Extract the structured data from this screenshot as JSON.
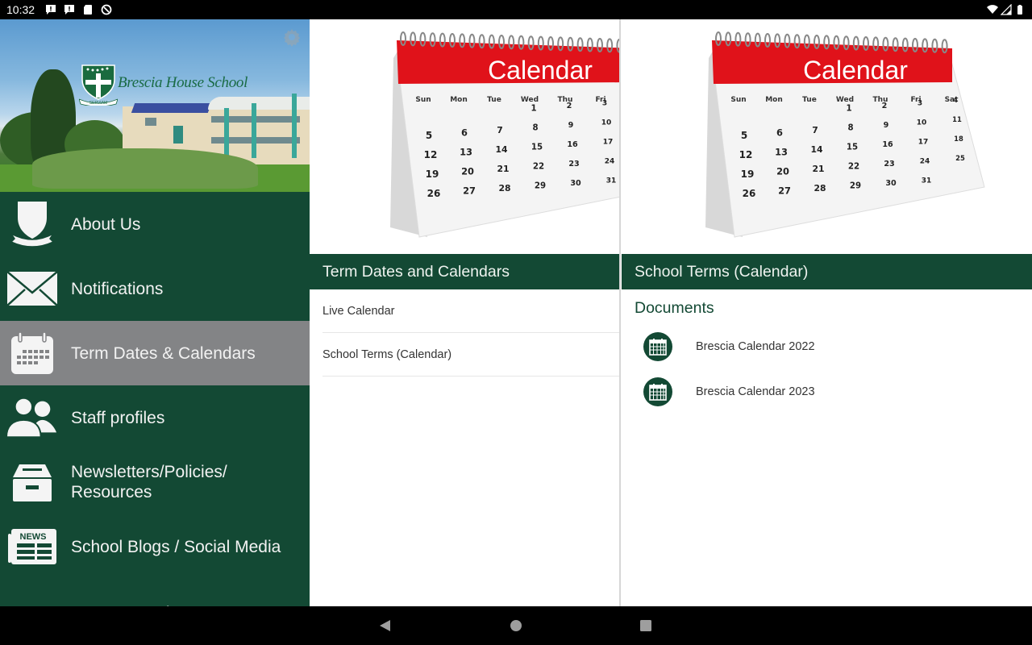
{
  "status_bar": {
    "time": "10:32",
    "left_icons": [
      "notification-alert-icon",
      "notification-alert-icon",
      "sd-card-icon",
      "data-saver-icon"
    ],
    "right_icons": [
      "wifi-icon",
      "cell-signal-icon",
      "battery-icon"
    ]
  },
  "sidebar": {
    "school_name": "Brescia House School",
    "crest_motto": "SERVIAM",
    "settings_icon": "gear-icon",
    "items": [
      {
        "label": "About Us",
        "icon": "crest-shield-icon",
        "active": false
      },
      {
        "label": "Notifications",
        "icon": "envelope-icon",
        "active": false
      },
      {
        "label": "Term Dates & Calendars",
        "icon": "calendar-icon",
        "active": true
      },
      {
        "label": "Staff profiles",
        "icon": "users-icon",
        "active": false
      },
      {
        "label": "Newsletters/Policies/\nResources",
        "label_line1": "Newsletters/Policies/",
        "label_line2": "Resources",
        "icon": "archive-box-icon",
        "active": false
      },
      {
        "label": "School Blogs / Social Media",
        "icon": "newspaper-icon",
        "news_text": "NEWS",
        "active": false
      },
      {
        "label": "Parent Portal",
        "icon": "pencil-icon",
        "active": false
      }
    ]
  },
  "middle_panel": {
    "header": "Term Dates and Calendars",
    "image_text": "Calendar",
    "items": [
      {
        "label": "Live Calendar"
      },
      {
        "label": "School Terms (Calendar)"
      }
    ]
  },
  "right_panel": {
    "header": "School Terms (Calendar)",
    "image_text": "Calendar",
    "section_title": "Documents",
    "documents": [
      {
        "label": "Brescia Calendar 2022",
        "icon": "calendar-doc-icon"
      },
      {
        "label": "Brescia Calendar 2023",
        "icon": "calendar-doc-icon"
      }
    ]
  },
  "calendar_illustration": {
    "weekdays": [
      "Sun",
      "Mon",
      "Tue",
      "Wed",
      "Thu",
      "Fri",
      "Sat"
    ],
    "first_weekday_index": 3,
    "days_in_month": 31
  },
  "nav_bar": {
    "buttons": [
      "back",
      "home",
      "recents"
    ]
  },
  "colors": {
    "brand_green": "#134934",
    "active_item": "#838486",
    "calendar_red": "#e0121a"
  }
}
